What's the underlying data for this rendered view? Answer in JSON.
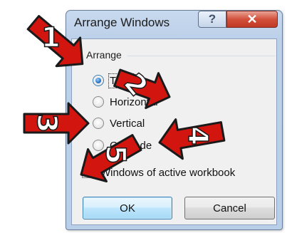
{
  "dialog": {
    "title": "Arrange Windows",
    "help_glyph": "?",
    "close_glyph": "✕"
  },
  "arrange": {
    "group_label": "Arrange",
    "options": [
      {
        "label": "Tiled",
        "checked": true
      },
      {
        "label": "Horizontal",
        "checked": false
      },
      {
        "label": "Vertical",
        "checked": false
      },
      {
        "label": "Cascade",
        "checked": false
      }
    ]
  },
  "active_workbook": {
    "label": "Windows of active workbook",
    "checked": false
  },
  "buttons": {
    "ok": "OK",
    "cancel": "Cancel"
  },
  "callouts": [
    "1",
    "2",
    "3",
    "4",
    "5"
  ],
  "colors": {
    "callout_fill": "#d2160f",
    "callout_outline": "#1a1a1a"
  }
}
